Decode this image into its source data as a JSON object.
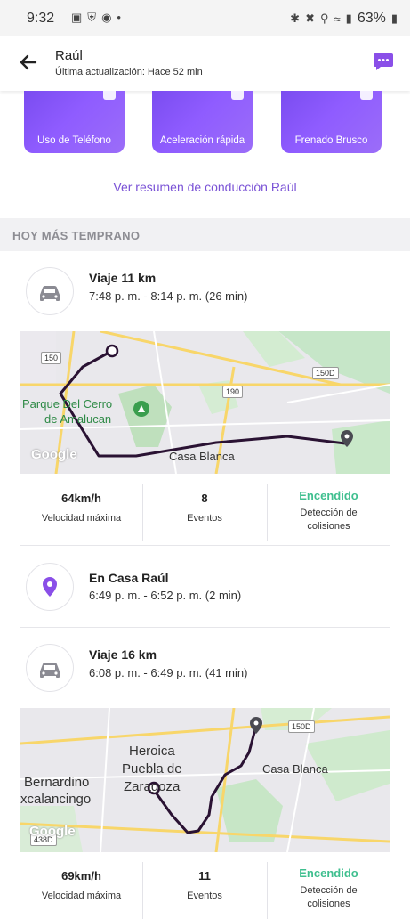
{
  "status_bar": {
    "time": "9:32",
    "left_icons": [
      "image-icon",
      "shield-icon",
      "instagram-icon",
      "dot-icon"
    ],
    "battery": "63%"
  },
  "header": {
    "name": "Raúl",
    "subtitle": "Última actualización: Hace 52 min"
  },
  "tiles": [
    {
      "label": "Uso de Teléfono"
    },
    {
      "label": "Aceleración rápida"
    },
    {
      "label": "Frenado Brusco"
    }
  ],
  "summary_link": "Ver resumen de conducción Raúl",
  "section_header": "HOY MÁS TEMPRANO",
  "timeline": {
    "trip1": {
      "title": "Viaje 11 km",
      "time": "7:48 p. m. - 8:14 p. m. (26 min)",
      "map_labels": {
        "road1": "150",
        "road2": "150D",
        "road3": "190",
        "park": "Parque Del Cerro",
        "park2": "de Amalucan",
        "place": "Casa Blanca",
        "google": "Google"
      },
      "stats": {
        "max_speed": "64km/h",
        "max_speed_label": "Velocidad máxima",
        "events": "8",
        "events_label": "Eventos",
        "crash": "Encendido",
        "crash_label1": "Detección de",
        "crash_label2": "colisiones"
      }
    },
    "place": {
      "title": "En Casa Raúl",
      "time": "6:49 p. m. - 6:52 p. m. (2 min)"
    },
    "trip2": {
      "title": "Viaje 16 km",
      "time": "6:08 p. m. - 6:49 p. m. (41 min)",
      "map_labels": {
        "road1": "150D",
        "road2": "438D",
        "city1": "Heroica",
        "city2": "Puebla de",
        "city3": "Zaragoza",
        "place": "Casa Blanca",
        "west1": "Bernardino",
        "west2": "xcalancingo",
        "google": "Google"
      },
      "stats": {
        "max_speed": "69km/h",
        "max_speed_label": "Velocidad máxima",
        "events": "11",
        "events_label": "Eventos",
        "crash": "Encendido",
        "crash_label1": "Detección de",
        "crash_label2": "colisiones"
      }
    }
  },
  "colors": {
    "accent": "#7a52d6",
    "green": "#3fbf8f",
    "route": "#2a1233"
  }
}
